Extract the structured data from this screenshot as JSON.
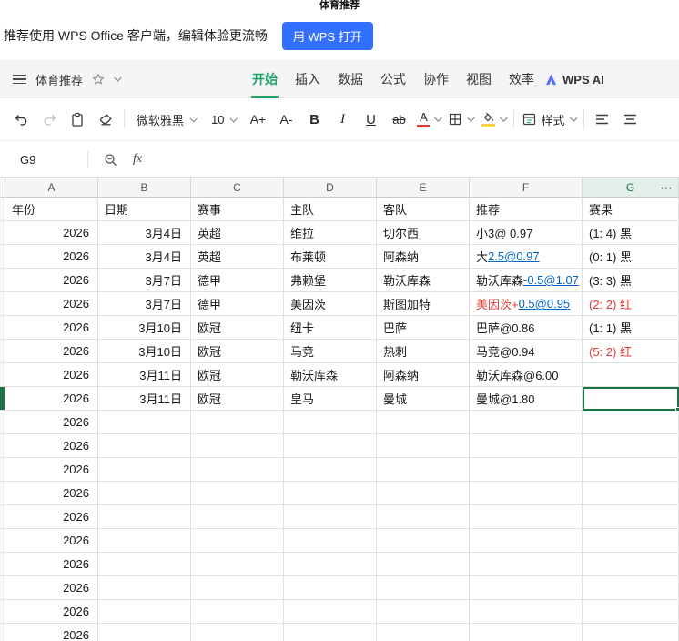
{
  "colors": {
    "accent_green": "#21a366",
    "selection_green": "#1e7145",
    "link_blue": "#0563c1",
    "alert_red": "#e53935",
    "open_button_blue": "#3370ff"
  },
  "titlebar": {
    "title": "体育推荐"
  },
  "banner": {
    "message": "推荐使用 WPS Office 客户端，编辑体验更流畅",
    "open_button": "用 WPS 打开"
  },
  "menubar": {
    "doc_title": "体育推荐",
    "tabs": [
      {
        "label": "开始",
        "active": true
      },
      {
        "label": "插入",
        "active": false
      },
      {
        "label": "数据",
        "active": false
      },
      {
        "label": "公式",
        "active": false
      },
      {
        "label": "协作",
        "active": false
      },
      {
        "label": "视图",
        "active": false
      },
      {
        "label": "效率",
        "active": false
      }
    ],
    "wps_ai_label": "WPS AI"
  },
  "toolbar": {
    "font_name": "微软雅黑",
    "font_size": "10",
    "font_grow": "A+",
    "font_shrink": "A-",
    "bold": "B",
    "italic": "I",
    "underline": "U",
    "strike": "ab",
    "font_color_letter": "A",
    "style_label": "样式"
  },
  "formula_bar": {
    "cell_ref": "G9",
    "fx_label": "fx"
  },
  "sheet": {
    "column_letters": [
      "A",
      "B",
      "C",
      "D",
      "E",
      "F",
      "G"
    ],
    "more_label": "⋯",
    "selected_cell": "G9",
    "header_row": {
      "year": "年份",
      "date": "日期",
      "league": "赛事",
      "home": "主队",
      "away": "客队",
      "rec": "推荐",
      "result": "赛果"
    },
    "rows": [
      {
        "year": "2026",
        "date": "3月4日",
        "league": "英超",
        "home": "维拉",
        "away": "切尔西",
        "rec": [
          {
            "t": "小3@ 0.97",
            "s": "plain"
          }
        ],
        "result": {
          "t": "(1: 4) 黑",
          "c": "black"
        },
        "selected": false
      },
      {
        "year": "2026",
        "date": "3月4日",
        "league": "英超",
        "home": "布莱顿",
        "away": "阿森纳",
        "rec": [
          {
            "t": "大",
            "s": "plain"
          },
          {
            "t": "2.5@0.97",
            "s": "link"
          }
        ],
        "result": {
          "t": "(0: 1) 黑",
          "c": "black"
        },
        "selected": false
      },
      {
        "year": "2026",
        "date": "3月7日",
        "league": "德甲",
        "home": "弗赖堡",
        "away": "勒沃库森",
        "rec": [
          {
            "t": "勒沃库森",
            "s": "plain"
          },
          {
            "t": "-0.5@1.07",
            "s": "link"
          }
        ],
        "result": {
          "t": "(3: 3) 黑",
          "c": "black"
        },
        "selected": false
      },
      {
        "year": "2026",
        "date": "3月7日",
        "league": "德甲",
        "home": "美因茨",
        "away": "斯图加特",
        "rec": [
          {
            "t": "美因茨+",
            "s": "red"
          },
          {
            "t": "0.5@0.95",
            "s": "link"
          }
        ],
        "result": {
          "t": "(2: 2) 红",
          "c": "red"
        },
        "selected": false
      },
      {
        "year": "2026",
        "date": "3月10日",
        "league": "欧冠",
        "home": "纽卡",
        "away": "巴萨",
        "rec": [
          {
            "t": "巴萨@0.86",
            "s": "plain"
          }
        ],
        "result": {
          "t": "(1: 1) 黑",
          "c": "black"
        },
        "selected": false
      },
      {
        "year": "2026",
        "date": "3月10日",
        "league": "欧冠",
        "home": "马竞",
        "away": "热刺",
        "rec": [
          {
            "t": "马竞@0.94",
            "s": "plain"
          }
        ],
        "result": {
          "t": "(5: 2) 红",
          "c": "red"
        },
        "selected": false
      },
      {
        "year": "2026",
        "date": "3月11日",
        "league": "欧冠",
        "home": "勒沃库森",
        "away": "阿森纳",
        "rec": [
          {
            "t": "勒沃库森@6.00",
            "s": "plain"
          }
        ],
        "result": {
          "t": "",
          "c": "black"
        },
        "selected": false
      },
      {
        "year": "2026",
        "date": "3月11日",
        "league": "欧冠",
        "home": "皇马",
        "away": "曼城",
        "rec": [
          {
            "t": "曼城@1.80",
            "s": "plain"
          }
        ],
        "result": {
          "t": "",
          "c": "black"
        },
        "selected": true
      }
    ],
    "empty_row_year": "2026",
    "empty_row_count": 10
  }
}
